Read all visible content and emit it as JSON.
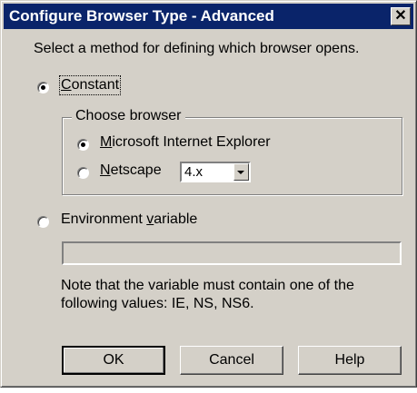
{
  "window": {
    "title": "Configure Browser Type - Advanced",
    "close_glyph": "✕"
  },
  "intro_text": "Select a method for defining which browser opens.",
  "constant": {
    "label": "Constant",
    "mnemonic": "C",
    "label_rest": "onstant",
    "checked": true
  },
  "choose_browser": {
    "group_label": "Choose browser",
    "ie": {
      "mnemonic": "M",
      "label_rest": "icrosoft Internet Explorer",
      "checked": true
    },
    "netscape": {
      "mnemonic": "N",
      "label_rest": "etscape",
      "checked": false
    },
    "version": {
      "selected": "4.x"
    }
  },
  "environment": {
    "label_prefix": "Environment ",
    "mnemonic": "v",
    "label_rest": "ariable",
    "checked": false,
    "value": ""
  },
  "note": {
    "line1": "Note that the variable must contain one of the",
    "line2": "following values: IE, NS, NS6."
  },
  "buttons": {
    "ok": "OK",
    "cancel": "Cancel",
    "help": "Help"
  }
}
